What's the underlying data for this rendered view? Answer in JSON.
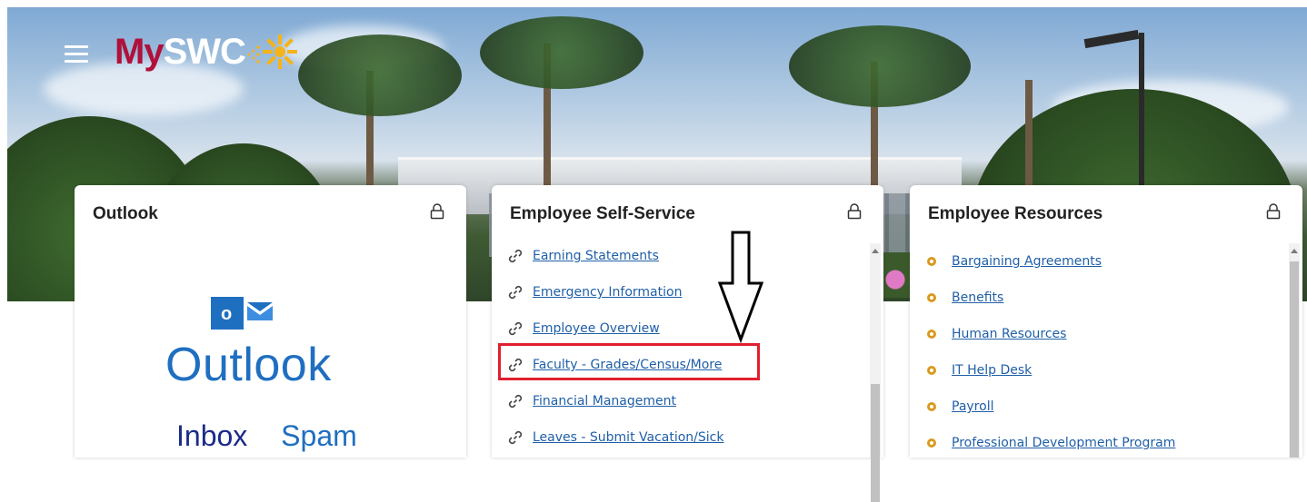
{
  "header": {
    "logo_my": "My",
    "logo_swc": "SWC",
    "menu_icon": "hamburger-menu-icon"
  },
  "cards": {
    "outlook": {
      "title": "Outlook",
      "logo_word": "Outlook",
      "links": [
        "Inbox",
        "Spam"
      ]
    },
    "self_service": {
      "title": "Employee Self-Service",
      "links": [
        "Earning Statements",
        "Emergency Information",
        "Employee Overview",
        "Faculty - Grades/Census/More",
        "Financial Management",
        "Leaves - Submit Vacation/Sick"
      ]
    },
    "resources": {
      "title": "Employee Resources",
      "links": [
        "Bargaining Agreements",
        "Benefits",
        "Human Resources",
        "IT Help Desk",
        "Payroll",
        "Professional Development Program"
      ]
    }
  },
  "colors": {
    "brand_red": "#b0103a",
    "brand_gold": "#f3b41b",
    "link_blue": "#1f5fa8",
    "highlight_red": "#e0202e"
  }
}
